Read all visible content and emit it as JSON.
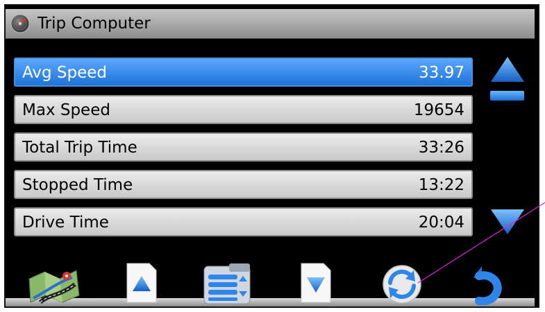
{
  "window": {
    "title": "Trip Computer"
  },
  "rows": [
    {
      "label": "Avg Speed",
      "value": "33.97",
      "selected": true
    },
    {
      "label": "Max Speed",
      "value": "19654",
      "selected": false
    },
    {
      "label": "Total Trip Time",
      "value": "33:26",
      "selected": false
    },
    {
      "label": "Stopped Time",
      "value": "13:22",
      "selected": false
    },
    {
      "label": "Drive Time",
      "value": "20:04",
      "selected": false
    }
  ],
  "icons": {
    "app": "speedometer-icon",
    "scroll_up": "triangle-up-icon",
    "scroll_down": "triangle-down-icon",
    "map": "map-icon",
    "page_up": "page-up-icon",
    "menu": "menu-list-icon",
    "page_down": "page-down-icon",
    "reset": "refresh-icon",
    "back": "back-arrow-icon"
  },
  "colors": {
    "selection": "#2f86ea",
    "accent_blue": "#1f73d7",
    "annotation": "#e020e0"
  }
}
